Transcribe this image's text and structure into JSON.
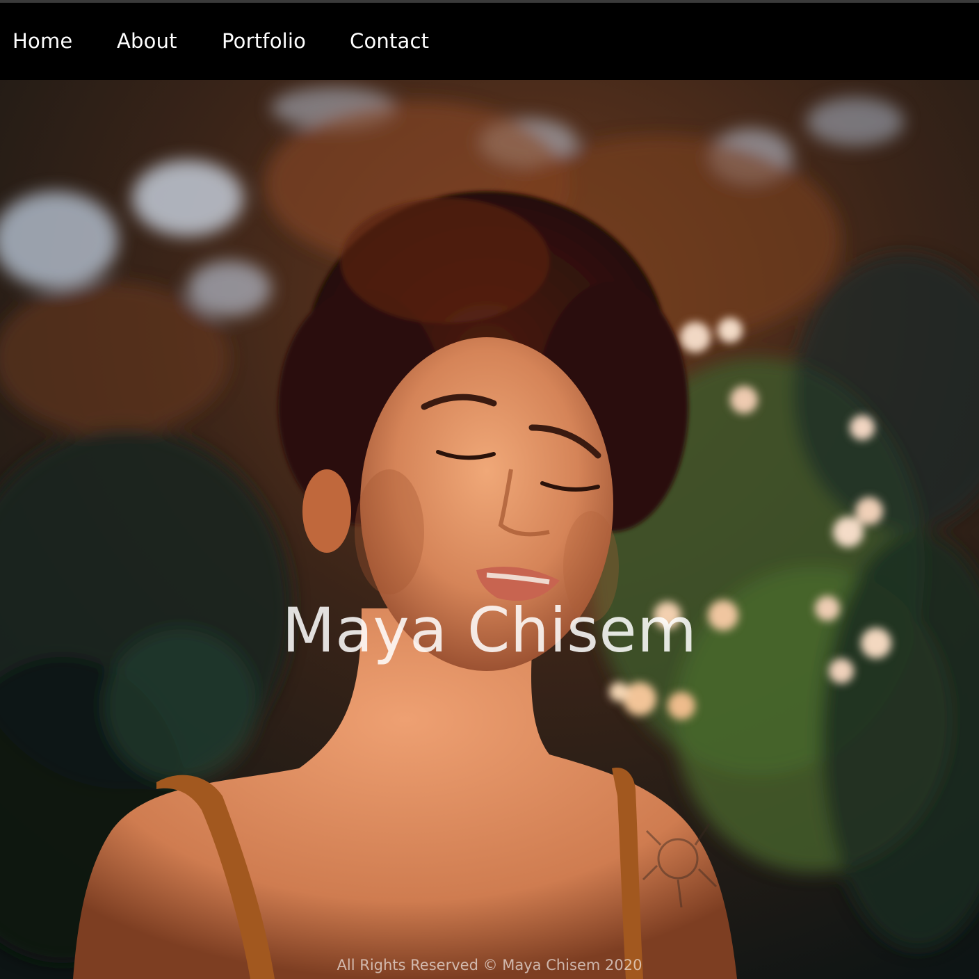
{
  "nav": {
    "items": [
      {
        "label": "Home"
      },
      {
        "label": "About"
      },
      {
        "label": "Portfolio"
      },
      {
        "label": "Contact"
      }
    ]
  },
  "hero": {
    "title": "Maya Chisem",
    "image_icon": "portrait-photo"
  },
  "footer": {
    "text": "All Rights Reserved © Maya Chisem 2020"
  },
  "colors": {
    "nav_background": "#000000",
    "nav_text": "#ffffff",
    "title_text": "#e8e8e8"
  }
}
